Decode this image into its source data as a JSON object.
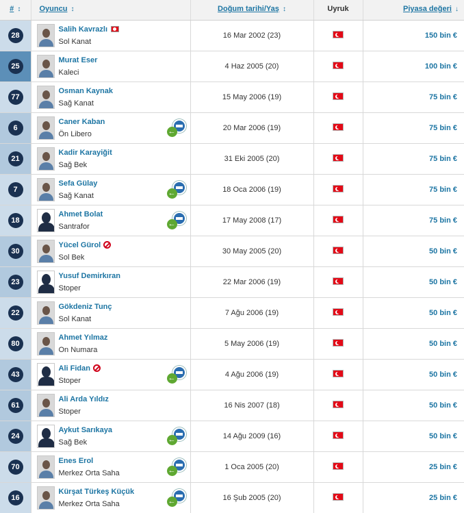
{
  "header": {
    "num": "#",
    "player": "Oyuncu",
    "dob": "Doğum tarihi/Yaş",
    "nat": "Uyruk",
    "value": "Piyasa değeri",
    "sort_both": "↕",
    "sort_down": "↓"
  },
  "colors": {
    "link": "#1d75a3",
    "badge": "#1a3151",
    "flag_red": "#e30a17",
    "loan_green": "#5fa832"
  },
  "players": [
    {
      "num": "28",
      "name": "Salih Kavrazlı",
      "pos": "Sol Kanat",
      "dob": "16 Mar 2002 (23)",
      "value": "150 bin €",
      "band": "light",
      "photo": "photo",
      "extra": "flag",
      "loan": false
    },
    {
      "num": "25",
      "name": "Murat Eser",
      "pos": "Kaleci",
      "dob": "4 Haz 2005 (20)",
      "value": "100 bin €",
      "band": "gk",
      "photo": "photo",
      "extra": "",
      "loan": false
    },
    {
      "num": "77",
      "name": "Osman Kaynak",
      "pos": "Sağ Kanat",
      "dob": "15 May 2006 (19)",
      "value": "75 bin €",
      "band": "light",
      "photo": "photo",
      "extra": "",
      "loan": false
    },
    {
      "num": "6",
      "name": "Caner Kaban",
      "pos": "Ön Libero",
      "dob": "20 Mar 2006 (19)",
      "value": "75 bin €",
      "band": "df",
      "photo": "photo",
      "extra": "",
      "loan": true
    },
    {
      "num": "21",
      "name": "Kadir Karayiğit",
      "pos": "Sağ Bek",
      "dob": "31 Eki 2005 (20)",
      "value": "75 bin €",
      "band": "df",
      "photo": "photo",
      "extra": "",
      "loan": false
    },
    {
      "num": "7",
      "name": "Sefa Gülay",
      "pos": "Sağ Kanat",
      "dob": "18 Oca 2006 (19)",
      "value": "75 bin €",
      "band": "light",
      "photo": "photo",
      "extra": "",
      "loan": true
    },
    {
      "num": "18",
      "name": "Ahmet Bolat",
      "pos": "Santrafor",
      "dob": "17 May 2008 (17)",
      "value": "75 bin €",
      "band": "light",
      "photo": "sil",
      "extra": "",
      "loan": true
    },
    {
      "num": "30",
      "name": "Yücel Gürol",
      "pos": "Sol Bek",
      "dob": "30 May 2005 (20)",
      "value": "50 bin €",
      "band": "df",
      "photo": "photo",
      "extra": "ban",
      "loan": false
    },
    {
      "num": "23",
      "name": "Yusuf Demirkıran",
      "pos": "Stoper",
      "dob": "22 Mar 2006 (19)",
      "value": "50 bin €",
      "band": "df",
      "photo": "sil",
      "extra": "",
      "loan": false
    },
    {
      "num": "22",
      "name": "Gökdeniz Tunç",
      "pos": "Sol Kanat",
      "dob": "7 Ağu 2006 (19)",
      "value": "50 bin €",
      "band": "light",
      "photo": "photo",
      "extra": "",
      "loan": false
    },
    {
      "num": "80",
      "name": "Ahmet Yılmaz",
      "pos": "On Numara",
      "dob": "5 May 2006 (19)",
      "value": "50 bin €",
      "band": "light",
      "photo": "photo",
      "extra": "",
      "loan": false
    },
    {
      "num": "43",
      "name": "Ali Fidan",
      "pos": "Stoper",
      "dob": "4 Ağu 2006 (19)",
      "value": "50 bin €",
      "band": "df",
      "photo": "sil",
      "extra": "ban",
      "loan": true
    },
    {
      "num": "61",
      "name": "Ali Arda Yıldız",
      "pos": "Stoper",
      "dob": "16 Nis 2007 (18)",
      "value": "50 bin €",
      "band": "df",
      "photo": "photo",
      "extra": "",
      "loan": false
    },
    {
      "num": "24",
      "name": "Aykut Sarıkaya",
      "pos": "Sağ Bek",
      "dob": "14 Ağu 2009 (16)",
      "value": "50 bin €",
      "band": "df",
      "photo": "sil",
      "extra": "",
      "loan": true
    },
    {
      "num": "70",
      "name": "Enes Erol",
      "pos": "Merkez Orta Saha",
      "dob": "1 Oca 2005 (20)",
      "value": "25 bin €",
      "band": "light",
      "photo": "photo",
      "extra": "",
      "loan": true
    },
    {
      "num": "16",
      "name": "Kürşat Türkeş Küçük",
      "pos": "Merkez Orta Saha",
      "dob": "16 Şub 2005 (20)",
      "value": "25 bin €",
      "band": "light",
      "photo": "photo",
      "extra": "",
      "loan": true
    }
  ]
}
